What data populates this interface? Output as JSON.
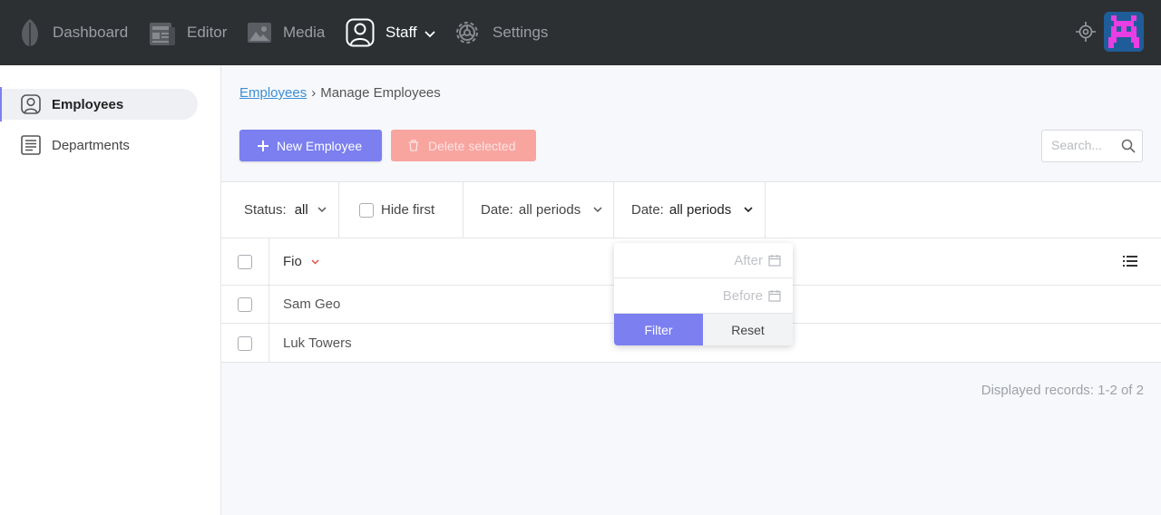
{
  "nav": {
    "items": [
      {
        "label": "Dashboard",
        "icon": "leaf-icon"
      },
      {
        "label": "Editor",
        "icon": "newspaper-icon"
      },
      {
        "label": "Media",
        "icon": "image-icon"
      },
      {
        "label": "Staff",
        "icon": "user-icon",
        "active": true
      },
      {
        "label": "Settings",
        "icon": "gear-icon"
      }
    ]
  },
  "sidebar": {
    "items": [
      {
        "label": "Employees",
        "icon": "user-icon",
        "active": true
      },
      {
        "label": "Departments",
        "icon": "list-icon"
      }
    ]
  },
  "breadcrumb": {
    "parent": "Employees",
    "separator": "›",
    "current": "Manage Employees"
  },
  "toolbar": {
    "new_label": "New Employee",
    "delete_label": "Delete selected"
  },
  "search": {
    "placeholder": "Search..."
  },
  "filters": {
    "status_label": "Status:",
    "status_value": "all",
    "hide_first_label": "Hide first",
    "date1_label": "Date:",
    "date1_value": "all periods",
    "date2_label": "Date:",
    "date2_value": "all periods"
  },
  "table": {
    "column_header": "Fio",
    "rows": [
      {
        "name": "Sam Geo"
      },
      {
        "name": "Luk Towers"
      }
    ]
  },
  "footer": {
    "displayed": "Displayed records: 1-2 of 2"
  },
  "date_popup": {
    "after_placeholder": "After",
    "before_placeholder": "Before",
    "filter_label": "Filter",
    "reset_label": "Reset"
  },
  "colors": {
    "accent": "#7b7ff0",
    "danger_light": "#f8a5a0",
    "topbar": "#2d3033",
    "link": "#3b8fd6"
  }
}
